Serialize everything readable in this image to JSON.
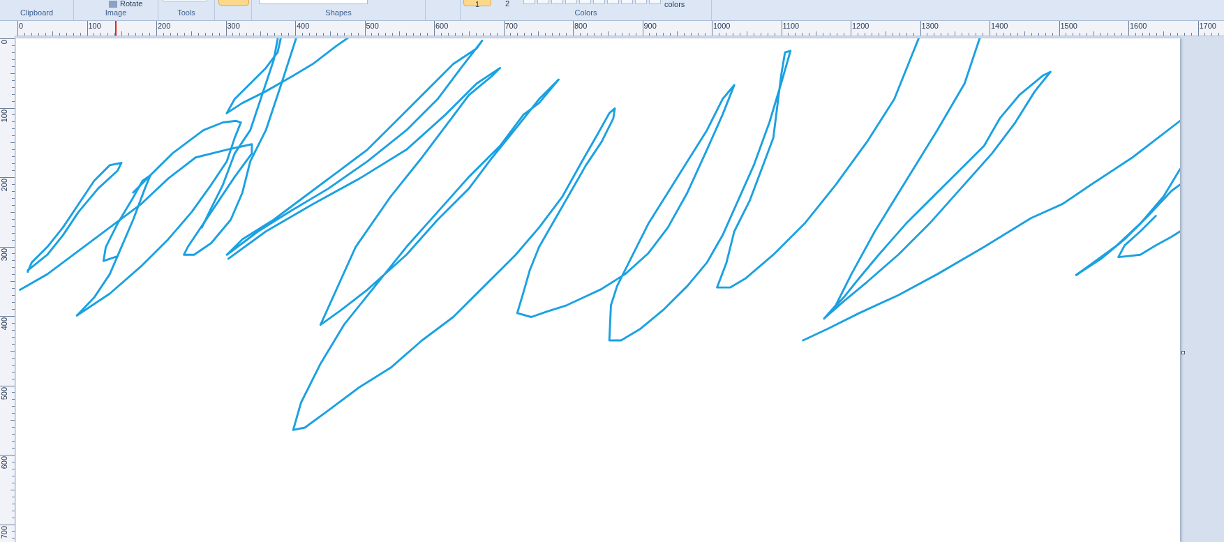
{
  "ribbon": {
    "groups": [
      {
        "kind": "clipboard",
        "label": "Clipboard"
      },
      {
        "kind": "image",
        "label": "Image",
        "button": "Rotate"
      },
      {
        "kind": "tools",
        "label": "Tools"
      },
      {
        "kind": "shapes",
        "label": "Shapes"
      },
      {
        "kind": "colors",
        "label": "Colors"
      }
    ],
    "colors": {
      "slots": [
        {
          "label": "1",
          "selected": true
        },
        {
          "label": "2",
          "selected": false
        }
      ],
      "edit_label": "colors"
    }
  },
  "rulers": {
    "horizontal": [
      "0",
      "100",
      "200",
      "300",
      "400",
      "500",
      "600",
      "700",
      "800",
      "900",
      "1000",
      "1100",
      "1200",
      "1300",
      "1400",
      "1500",
      "1600",
      "1700"
    ],
    "vertical": [
      "0",
      "100",
      "200",
      "300",
      "400",
      "500",
      "600",
      "700"
    ]
  }
}
